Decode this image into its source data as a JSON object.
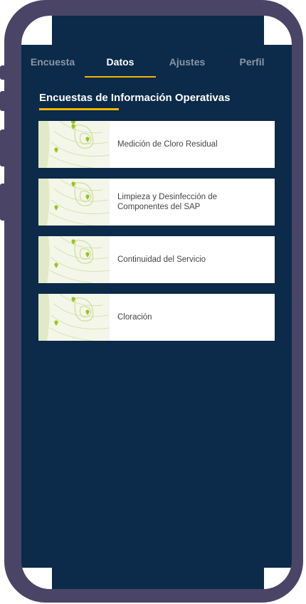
{
  "tabs": [
    {
      "label": "Encuesta",
      "active": false
    },
    {
      "label": "Datos",
      "active": true
    },
    {
      "label": "Ajustes",
      "active": false
    },
    {
      "label": "Perfil",
      "active": false
    }
  ],
  "section": {
    "title": "Encuestas de Información Operativas"
  },
  "surveys": [
    {
      "label": "Medición de Cloro Residual",
      "icon": "map-thumbnail-icon"
    },
    {
      "label": "Limpieza y Desinfección de Componentes del SAP",
      "icon": "map-thumbnail-icon"
    },
    {
      "label": "Continuidad del Servicio",
      "icon": "map-thumbnail-icon"
    },
    {
      "label": "Cloración",
      "icon": "map-thumbnail-icon"
    }
  ],
  "colors": {
    "background": "#0c2a49",
    "accent": "#f2b705",
    "frame": "#4a4566",
    "tab_inactive": "#8a97a7",
    "card_text": "#444444",
    "map_pin": "#9bc41a"
  }
}
